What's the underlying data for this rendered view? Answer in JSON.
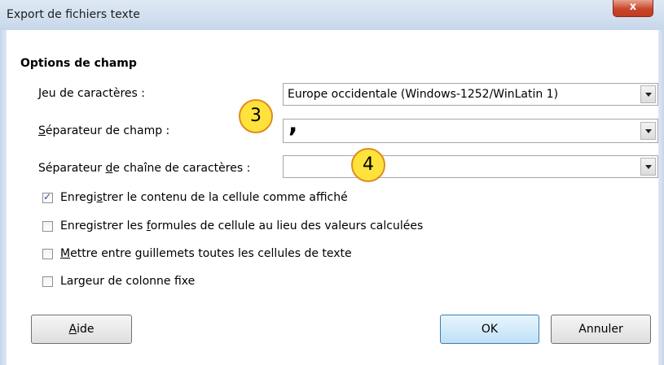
{
  "window": {
    "title": "Export de fichiers texte",
    "close_label": "x"
  },
  "section": {
    "title": "Options de champ"
  },
  "fields": {
    "charset": {
      "label_pre": "",
      "label_u": "J",
      "label_post": "eu de caractères :",
      "value": "Europe occidentale (Windows-1252/WinLatin 1)"
    },
    "field_sep": {
      "label_pre": "",
      "label_u": "S",
      "label_post": "éparateur de champ :",
      "value": ","
    },
    "string_sep": {
      "label_pre": "Séparateur ",
      "label_u": "d",
      "label_post": "e chaîne de caractères :",
      "value": ""
    }
  },
  "badges": {
    "b3": "3",
    "b4": "4"
  },
  "options": [
    {
      "pre": "Enregi",
      "u": "s",
      "post": "trer le contenu de la cellule comme affiché",
      "checked": true
    },
    {
      "pre": "Enregistrer les ",
      "u": "f",
      "post": "ormules de cellule au lieu des valeurs calculées",
      "checked": false
    },
    {
      "pre": "",
      "u": "M",
      "post": "ettre entre guillemets toutes les cellules de texte",
      "checked": false
    },
    {
      "pre": "Largeur de colonne f",
      "u": "i",
      "post": "xe",
      "checked": false
    }
  ],
  "buttons": {
    "help": {
      "u": "A",
      "post": "ide"
    },
    "ok": "OK",
    "cancel": "Annuler"
  },
  "colors": {
    "title_bar": "#c7d7ea",
    "close": "#c9462c",
    "badge_fill": "#ffe33c",
    "badge_border": "#e08b1c",
    "ok_button": "#bfe0f7"
  }
}
